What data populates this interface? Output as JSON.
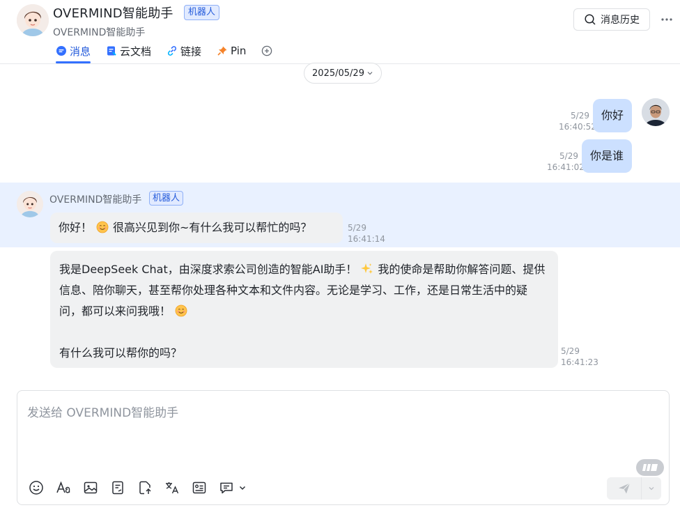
{
  "header": {
    "title": "OVERMIND智能助手",
    "robot_tag": "机器人",
    "subtitle": "OVERMIND智能助手",
    "tabs": [
      {
        "label": "消息",
        "icon": "chat-bubble-icon",
        "active": true
      },
      {
        "label": "云文档",
        "icon": "doc-icon",
        "active": false
      },
      {
        "label": "链接",
        "icon": "link-icon",
        "active": false
      },
      {
        "label": "Pin",
        "icon": "pin-icon",
        "active": false
      }
    ],
    "history_button": "消息历史"
  },
  "date_divider": "2025/05/29",
  "messages": {
    "user": [
      {
        "text": "你好",
        "date": "5/29",
        "time": "16:40:52"
      },
      {
        "text": "你是谁",
        "date": "5/29",
        "time": "16:41:02"
      }
    ],
    "bot": {
      "name": "OVERMIND智能助手",
      "tag": "机器人",
      "reply1": {
        "pre": "你好！",
        "post": "很高兴见到你~有什么我可以帮忙的吗？",
        "date": "5/29",
        "time": "16:41:14"
      },
      "reply2": {
        "part1": "我是DeepSeek Chat，由深度求索公司创造的智能AI助手！",
        "part2": "我的使命是帮助你解答问题、提供信息、陪你聊天，甚至帮你处理各种文本和文件内容。无论是学习、工作，还是日常生活中的疑问，都可以来问我哦！",
        "part3": "有什么我可以帮你的吗？",
        "date": "5/29",
        "time": "16:41:23"
      }
    }
  },
  "composer": {
    "placeholder": "发送给 OVERMIND智能助手",
    "value": ""
  },
  "colors": {
    "accent": "#3370ff",
    "user_bubble": "#cce0ff",
    "bot_bubble": "#f0f1f2",
    "highlight": "#e9f1ff"
  }
}
